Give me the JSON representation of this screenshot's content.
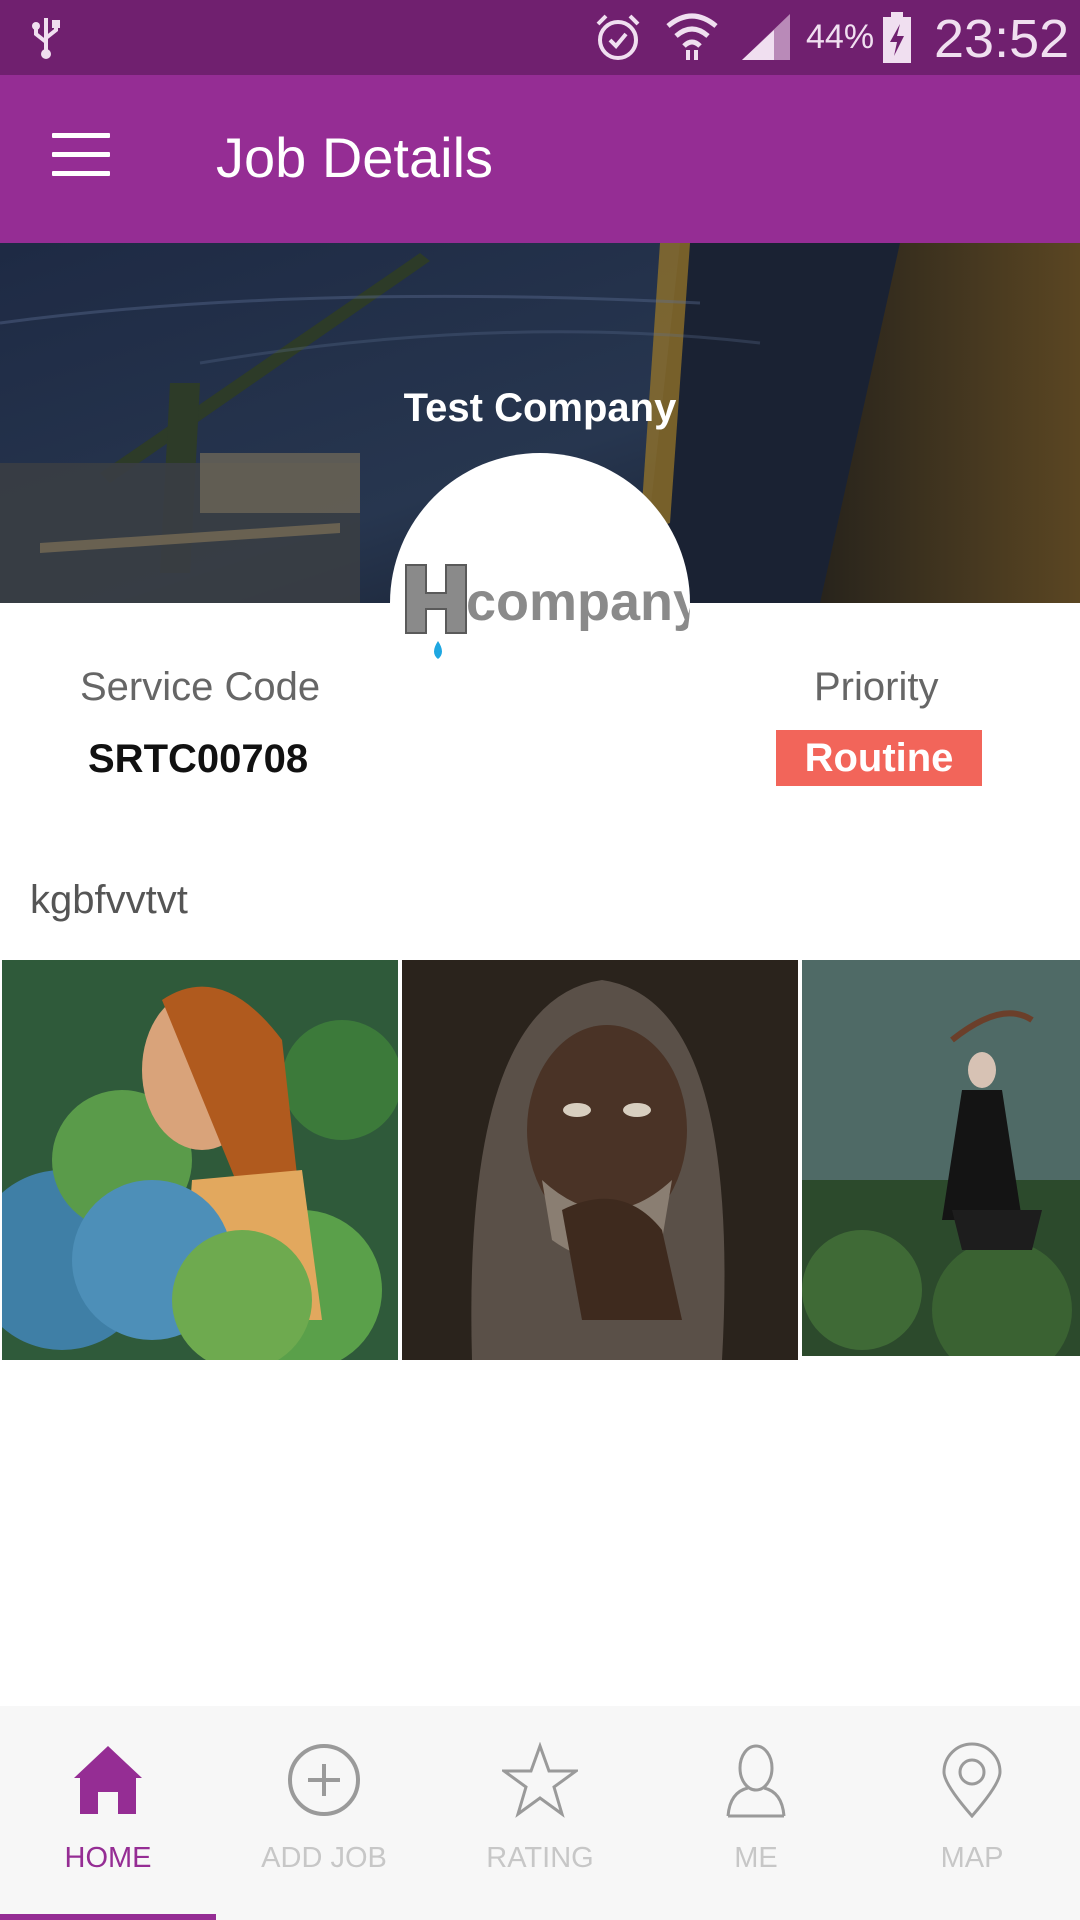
{
  "status_bar": {
    "battery_percent": "44%",
    "time": "23:52",
    "icons": [
      "usb-icon",
      "alarm-icon",
      "wifi-icon",
      "signal-icon",
      "battery-charging-icon"
    ]
  },
  "app_bar": {
    "title": "Job Details",
    "menu_icon": "hamburger-menu-icon",
    "background": "#952d94"
  },
  "hero": {
    "company_name": "Test Company",
    "logo_text": "company",
    "logo_letter": "H"
  },
  "details": {
    "service_code_label": "Service Code",
    "service_code": "SRTC00708",
    "priority_label": "Priority",
    "priority": "Routine",
    "priority_color": "#f2655a"
  },
  "description": "kgbfvvtvt",
  "gallery": [
    {
      "name": "photo-1"
    },
    {
      "name": "photo-2"
    },
    {
      "name": "photo-3"
    }
  ],
  "bottom_nav": {
    "items": [
      {
        "label": "HOME",
        "icon": "home-icon",
        "active": true
      },
      {
        "label": "ADD JOB",
        "icon": "add-circle-icon",
        "active": false
      },
      {
        "label": "RATING",
        "icon": "star-icon",
        "active": false
      },
      {
        "label": "ME",
        "icon": "person-icon",
        "active": false
      },
      {
        "label": "MAP",
        "icon": "map-pin-icon",
        "active": false
      }
    ],
    "active_color": "#952d94",
    "inactive_color": "#c7c7c7"
  }
}
